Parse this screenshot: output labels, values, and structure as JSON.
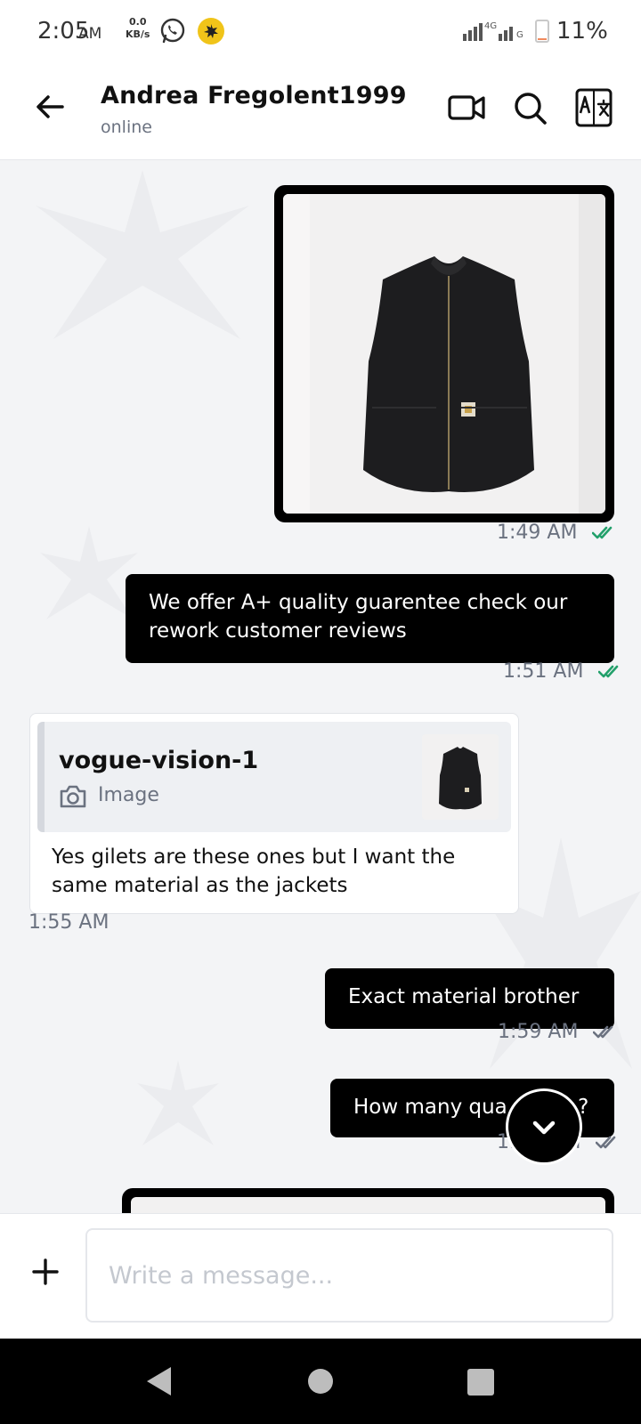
{
  "status_bar": {
    "time": "2:05",
    "ampm": "AM",
    "net_speed_value": "0.0",
    "net_speed_unit": "KB/s",
    "network_label": "4G",
    "network_label_2": "G",
    "battery_percent": "11%",
    "battery_level": 0.11,
    "icons": [
      "whatsapp-icon",
      "app-notification-icon",
      "signal-icon",
      "battery-icon"
    ]
  },
  "header": {
    "contact_name": "Andrea Fregolent1999",
    "presence": "online",
    "icons": [
      "back-arrow-icon",
      "video-call-icon",
      "search-icon",
      "translate-icon"
    ]
  },
  "messages": [
    {
      "direction": "out",
      "type": "image",
      "image_subject": "black zip vest",
      "time": "1:49 AM",
      "status": "read"
    },
    {
      "direction": "out",
      "type": "text",
      "text_line1": "We offer A+ quality guarentee check our",
      "text_line2": "rework customer reviews",
      "time": "1:51 AM",
      "status": "read"
    },
    {
      "direction": "in",
      "type": "reply",
      "quoted_sender": "vogue-vision-1",
      "quoted_type": "Image",
      "text_line1": "Yes gilets are these ones but I want the",
      "text_line2": "same material as the jackets",
      "time": "1:55 AM"
    },
    {
      "direction": "out",
      "type": "text",
      "text": "Exact material brother",
      "time": "1:59 AM",
      "status": "delivered"
    },
    {
      "direction": "out",
      "type": "text",
      "text": "How many qua",
      "text_tail": "?",
      "time_prefix": "1:5",
      "time_suffix": "AM",
      "status": "delivered"
    }
  ],
  "composer": {
    "placeholder": "Write a message..."
  },
  "colors": {
    "read_ticks": "#22a06b",
    "delivered_ticks": "#6b7280",
    "bubble_out": "#000000",
    "bubble_in": "#ffffff",
    "background": "#f3f4f6"
  }
}
